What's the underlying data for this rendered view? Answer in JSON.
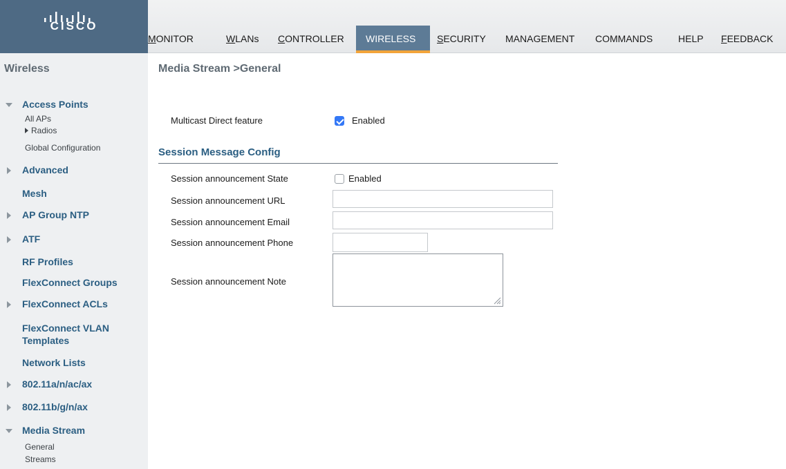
{
  "brand": {
    "logo_text": "CISCO"
  },
  "nav": {
    "items": [
      {
        "label": "MONITOR",
        "mnemonic": "M",
        "rest": "ONITOR"
      },
      {
        "label": "WLANs",
        "mnemonic": "W",
        "rest": "LANs"
      },
      {
        "label": "CONTROLLER",
        "mnemonic": "C",
        "rest": "ONTROLLER"
      },
      {
        "label": "WIRELESS",
        "mnemonic": "",
        "rest": "WIRELESS",
        "active": true
      },
      {
        "label": "SECURITY",
        "mnemonic": "S",
        "rest": "ECURITY"
      },
      {
        "label": "MANAGEMENT",
        "mnemonic": "",
        "rest": "MANAGEMENT"
      },
      {
        "label": "COMMANDS",
        "mnemonic": "",
        "rest": "COMMANDS"
      },
      {
        "label": "HELP",
        "mnemonic": "",
        "rest": "HELP"
      },
      {
        "label": "FEEDBACK",
        "mnemonic": "F",
        "rest": "EEDBACK"
      }
    ],
    "accent_color": "#f2a43a",
    "active_bg": "#5d7b96"
  },
  "sidebar": {
    "title": "Wireless",
    "groups": [
      {
        "label": "Access Points",
        "expanded": true,
        "subitems": [
          "All APs",
          "Radios",
          "Global Configuration"
        ]
      },
      {
        "label": "Advanced",
        "expanded": false
      },
      {
        "label": "Mesh"
      },
      {
        "label": "AP Group NTP",
        "expanded": false
      },
      {
        "label": "ATF",
        "expanded": false
      },
      {
        "label": "RF Profiles"
      },
      {
        "label": "FlexConnect Groups"
      },
      {
        "label": "FlexConnect ACLs",
        "expanded": false
      },
      {
        "label": "FlexConnect VLAN",
        "label_line2": "Templates"
      },
      {
        "label": "Network Lists"
      },
      {
        "label": "802.11a/n/ac/ax",
        "expanded": false
      },
      {
        "label": "802.11b/g/n/ax",
        "expanded": false
      },
      {
        "label": "Media Stream",
        "expanded": true,
        "subitems": [
          "General",
          "Streams"
        ]
      }
    ]
  },
  "main": {
    "title": "Media Stream >General",
    "multicast": {
      "label": "Multicast Direct feature",
      "checkbox_label": "Enabled",
      "checked": true
    },
    "section_heading": "Session Message Config",
    "session_state": {
      "label": "Session announcement State",
      "checkbox_label": "Enabled",
      "checked": false
    },
    "session_url": {
      "label": "Session announcement URL",
      "value": ""
    },
    "session_email": {
      "label": "Session announcement Email",
      "value": ""
    },
    "session_phone": {
      "label": "Session announcement Phone",
      "value": ""
    },
    "session_note": {
      "label": "Session announcement Note",
      "value": ""
    }
  }
}
